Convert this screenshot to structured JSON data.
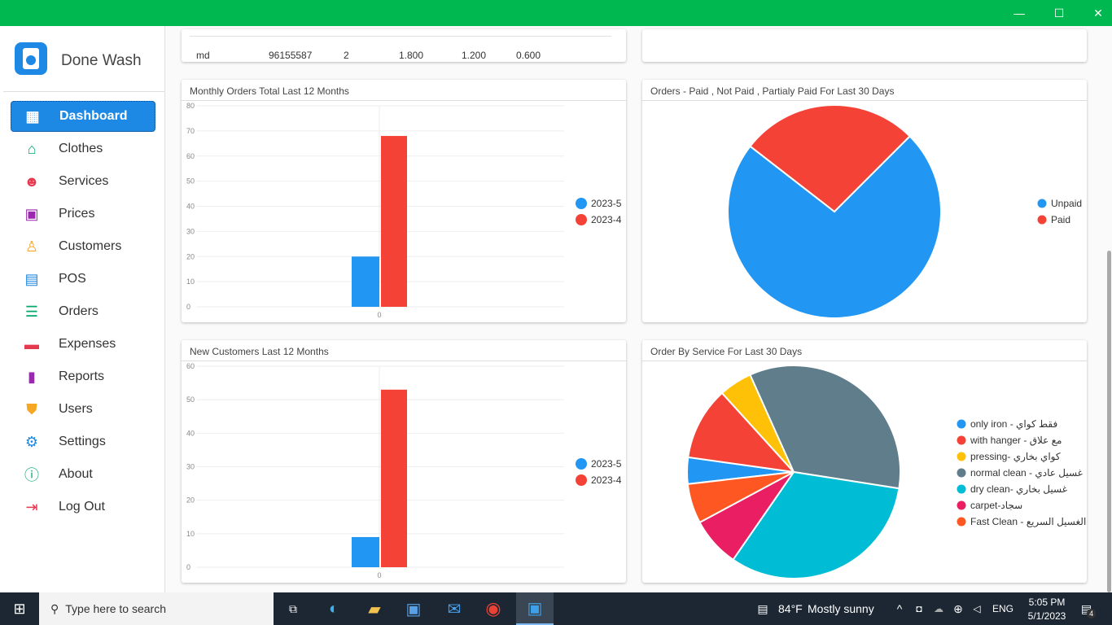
{
  "window": {
    "minimize": "—",
    "maximize": "☐",
    "close": "✕"
  },
  "app": {
    "name": "Done Wash"
  },
  "sidebar": {
    "items": [
      {
        "label": "Dashboard",
        "icon": "dashboard-icon",
        "glyph": "▦",
        "color": "#ffffff"
      },
      {
        "label": "Clothes",
        "icon": "hanger-icon",
        "glyph": "⌂",
        "color": "#00a86b"
      },
      {
        "label": "Services",
        "icon": "services-icon",
        "glyph": "☻",
        "color": "#e53950"
      },
      {
        "label": "Prices",
        "icon": "prices-icon",
        "glyph": "▣",
        "color": "#9c27b0"
      },
      {
        "label": "Customers",
        "icon": "customers-icon",
        "glyph": "♙",
        "color": "#f5a623"
      },
      {
        "label": "POS",
        "icon": "pos-icon",
        "glyph": "▤",
        "color": "#1e88e5"
      },
      {
        "label": "Orders",
        "icon": "orders-icon",
        "glyph": "☰",
        "color": "#00a86b"
      },
      {
        "label": "Expenses",
        "icon": "expenses-icon",
        "glyph": "▬",
        "color": "#e53950"
      },
      {
        "label": "Reports",
        "icon": "reports-icon",
        "glyph": "▮",
        "color": "#9c27b0"
      },
      {
        "label": "Users",
        "icon": "shield-icon",
        "glyph": "⛊",
        "color": "#f5a623"
      },
      {
        "label": "Settings",
        "icon": "gear-icon",
        "glyph": "⚙",
        "color": "#1e88e5"
      },
      {
        "label": "About",
        "icon": "info-icon",
        "glyph": "ⓘ",
        "color": "#00a86b"
      },
      {
        "label": "Log Out",
        "icon": "logout-icon",
        "glyph": "⇥",
        "color": "#e53950"
      }
    ]
  },
  "top_table": {
    "row": [
      "md",
      "96155587",
      "2",
      "1.800",
      "1.200",
      "0.600"
    ]
  },
  "chart_data": [
    {
      "type": "bar",
      "title": "Monthly Orders Total Last 12 Months",
      "categories": [
        "0"
      ],
      "series": [
        {
          "name": "2023-5",
          "color": "#2196f3",
          "values": [
            20
          ]
        },
        {
          "name": "2023-4",
          "color": "#f44336",
          "values": [
            68
          ]
        }
      ],
      "ylim": [
        0,
        80
      ],
      "yticks": [
        "0",
        "10",
        "20",
        "30",
        "40",
        "50",
        "60",
        "70",
        "80"
      ]
    },
    {
      "type": "pie",
      "title": "Orders - Paid , Not Paid , Partialy Paid For Last 30 Days",
      "slices": [
        {
          "label": "Unpaid",
          "value": 73,
          "color": "#2196f3"
        },
        {
          "label": "Paid",
          "value": 27,
          "color": "#f44336"
        }
      ]
    },
    {
      "type": "bar",
      "title": "New Customers Last 12 Months",
      "categories": [
        "0"
      ],
      "series": [
        {
          "name": "2023-5",
          "color": "#2196f3",
          "values": [
            9
          ]
        },
        {
          "name": "2023-4",
          "color": "#f44336",
          "values": [
            53
          ]
        }
      ],
      "ylim": [
        0,
        60
      ],
      "yticks": [
        "0",
        "10",
        "20",
        "30",
        "40",
        "50",
        "60"
      ]
    },
    {
      "type": "pie",
      "title": "Order By Service For Last 30 Days",
      "slices": [
        {
          "label": "only iron - فقط كواي",
          "value": 4,
          "color": "#2196f3"
        },
        {
          "label": "with hanger - مع علاق",
          "value": 11,
          "color": "#f44336"
        },
        {
          "label": "pressing- كواي بخاري",
          "value": 5,
          "color": "#ffc107"
        },
        {
          "label": "normal clean - غسيل عادي",
          "value": 34,
          "color": "#607d8b"
        },
        {
          "label": "dry clean-  غسيل بخاري",
          "value": 32,
          "color": "#00bcd4"
        },
        {
          "label": "carpet-سجاد",
          "value": 7.5,
          "color": "#e91e63"
        },
        {
          "label": "Fast Clean - الغسيل السريع",
          "value": 6,
          "color": "#ff5722"
        }
      ]
    }
  ],
  "taskbar": {
    "search_placeholder": "Type here to search",
    "weather_temp": "84°F",
    "weather_text": "Mostly sunny",
    "lang": "ENG",
    "time": "5:05 PM",
    "date": "5/1/2023",
    "notifications": "4"
  }
}
